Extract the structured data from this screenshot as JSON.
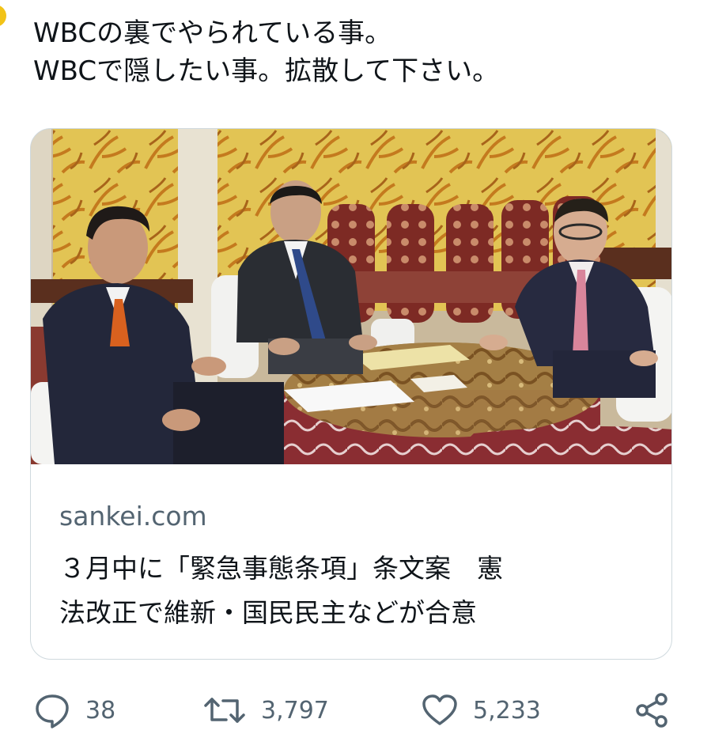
{
  "tweet": {
    "lines": [
      "WBCの裏でやられている事。",
      "WBCで隠したい事。拡散して下さい。"
    ]
  },
  "card": {
    "domain": "sankei.com",
    "title_lines": [
      "３月中に「緊急事態条項」条文案　憲",
      "法改正で維新・国民民主などが合意"
    ]
  },
  "actions": {
    "replies": "38",
    "retweets": "3,797",
    "likes": "5,233"
  },
  "colors": {
    "text": "#0f1419",
    "secondary": "#536471",
    "border": "#cfd9de",
    "avatar": "#f2c318"
  },
  "icons": [
    "reply-icon",
    "retweet-icon",
    "like-icon",
    "share-icon"
  ]
}
